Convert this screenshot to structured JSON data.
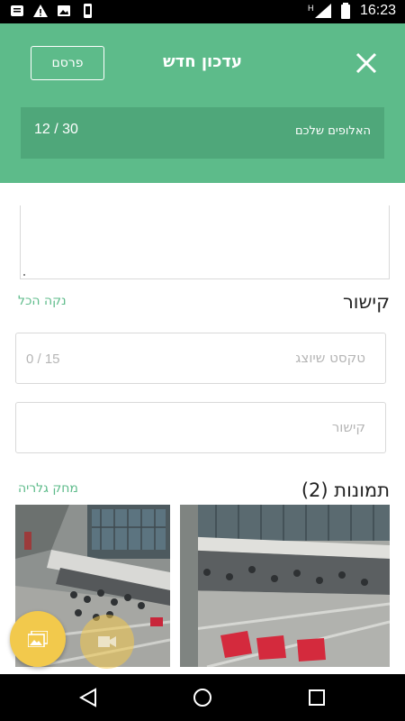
{
  "status_bar": {
    "time": "16:23",
    "left_icons": [
      "notification-icon",
      "warning-icon",
      "image-icon",
      "phone-icon"
    ],
    "right_icons": [
      "signal-icon",
      "battery-icon"
    ]
  },
  "header": {
    "publish_label": "פרסם",
    "title": "עדכון חדש",
    "close_icon": "close-icon",
    "group_name": "האלופים שלכם",
    "group_count": "12 / 30",
    "bg_color": "#5dbb8a",
    "group_bg_color": "#4fa77a"
  },
  "link_section": {
    "title": "קישור",
    "clear_label": "נקה הכל",
    "display_text_placeholder": "טקסט שיוצג",
    "display_text_counter": "0 / 15",
    "url_placeholder": "קישור"
  },
  "photos_section": {
    "title": "תמונות (2)",
    "delete_gallery_label": "מחק גלריה",
    "photos": [
      "plaza-photo-1",
      "plaza-photo-2"
    ]
  },
  "fab": {
    "gallery_icon": "gallery-icon",
    "camera_icon": "video-icon",
    "color": "#f2c94c"
  },
  "nav_bar": {
    "buttons": [
      "back-icon",
      "home-icon",
      "recents-icon"
    ]
  }
}
